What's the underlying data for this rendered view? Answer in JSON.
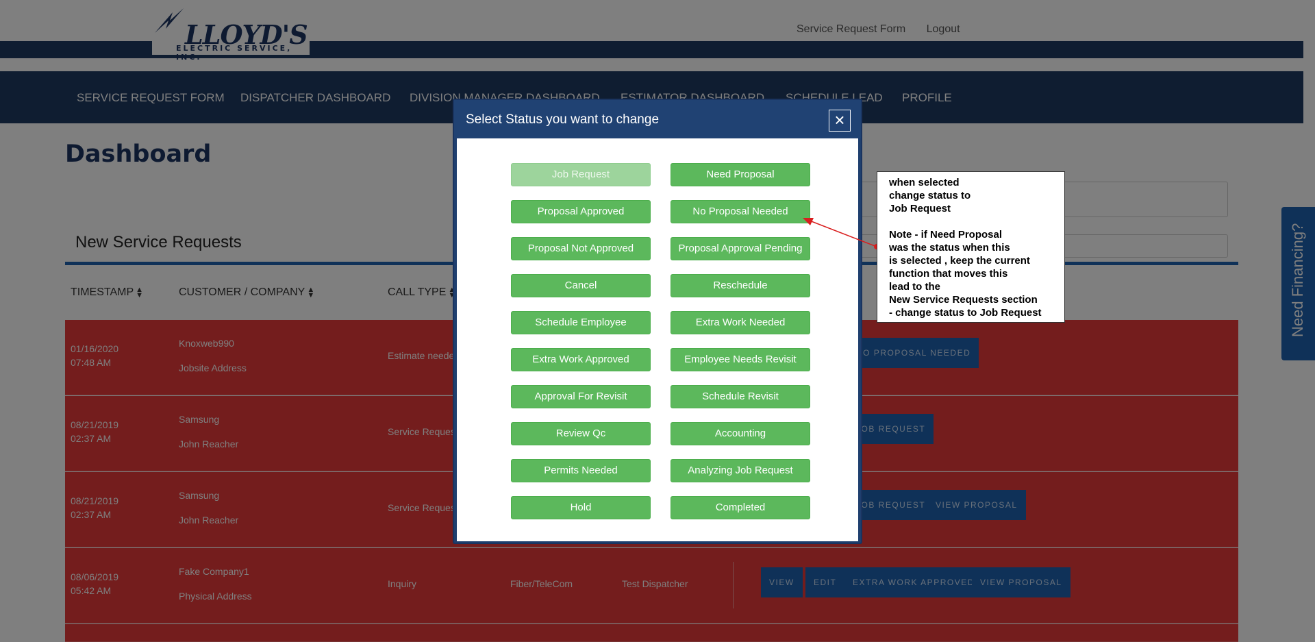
{
  "header": {
    "logo_text": "LLOYD'S",
    "logo_subtext": "ELECTRIC SERVICE, INC.",
    "links": [
      "Service Request Form",
      "Logout"
    ]
  },
  "nav": {
    "items": [
      "SERVICE REQUEST FORM",
      "DISPATCHER DASHBOARD",
      "DIVISION MANAGER DASHBOARD",
      "ESTIMATOR DASHBOARD",
      "SCHEDULE LEAD",
      "PROFILE"
    ]
  },
  "dashboard": {
    "title": "Dashboard",
    "section_title": "New Service Requests",
    "columns": [
      "TIMESTAMP",
      "CUSTOMER / COMPANY",
      "CALL TYPE"
    ],
    "rows": [
      {
        "date": "01/16/2020",
        "time": "07:48 AM",
        "customer": "Knoxweb990",
        "address": "Jobsite Address",
        "call_type": "Estimate neede",
        "utility": "",
        "dispatcher": "",
        "buttons": [
          "NO PROPOSAL NEEDED"
        ]
      },
      {
        "date": "08/21/2019",
        "time": "02:37 AM",
        "customer": "Samsung",
        "address": "John Reacher",
        "call_type": "Service Reques",
        "utility": "",
        "dispatcher": "",
        "buttons": [
          "JOB REQUEST"
        ]
      },
      {
        "date": "08/21/2019",
        "time": "02:37 AM",
        "customer": "Samsung",
        "address": "John Reacher",
        "call_type": "Service Reques",
        "utility": "",
        "dispatcher": "",
        "buttons": [
          "JOB REQUEST",
          "VIEW PROPOSAL"
        ]
      },
      {
        "date": "08/06/2019",
        "time": "05:42 AM",
        "customer": "Fake Company1",
        "address": "Physical Address",
        "call_type": "Inquiry",
        "utility": "Fiber/TeleCom",
        "dispatcher": "Test Dispatcher",
        "buttons": [
          "VIEW",
          "EDIT",
          "EXTRA WORK APPROVED",
          "VIEW PROPOSAL"
        ]
      }
    ],
    "financing_label": "Need Financing?"
  },
  "modal": {
    "title": "Select Status you want to change",
    "close_label": "×",
    "statuses": [
      "Job Request",
      "Need Proposal",
      "Proposal Approved",
      "No Proposal Needed",
      "Proposal Not Approved",
      "Proposal Approval Pending",
      "Cancel",
      "Reschedule",
      "Schedule Employee",
      "Extra Work Needed",
      "Extra Work Approved",
      "Employee Needs Revisit",
      "Approval For Revisit",
      "Schedule Revisit",
      "Review Qc",
      "Accounting",
      "Permits Needed",
      "Analyzing Job Request",
      "Hold",
      "Completed"
    ]
  },
  "annotation": {
    "lines": [
      "when selected",
      "change status to",
      "Job Request",
      "",
      "Note - if Need Proposal",
      "was the status when this",
      "is selected , keep the current",
      "function that moves this",
      "lead to the",
      "New Service Requests section",
      "- change status to Job Request"
    ]
  },
  "colors": {
    "navy": "#1f3a63",
    "accent_blue": "#1f62b0",
    "row_red": "#e83a3a",
    "status_green": "#5cb85c"
  }
}
